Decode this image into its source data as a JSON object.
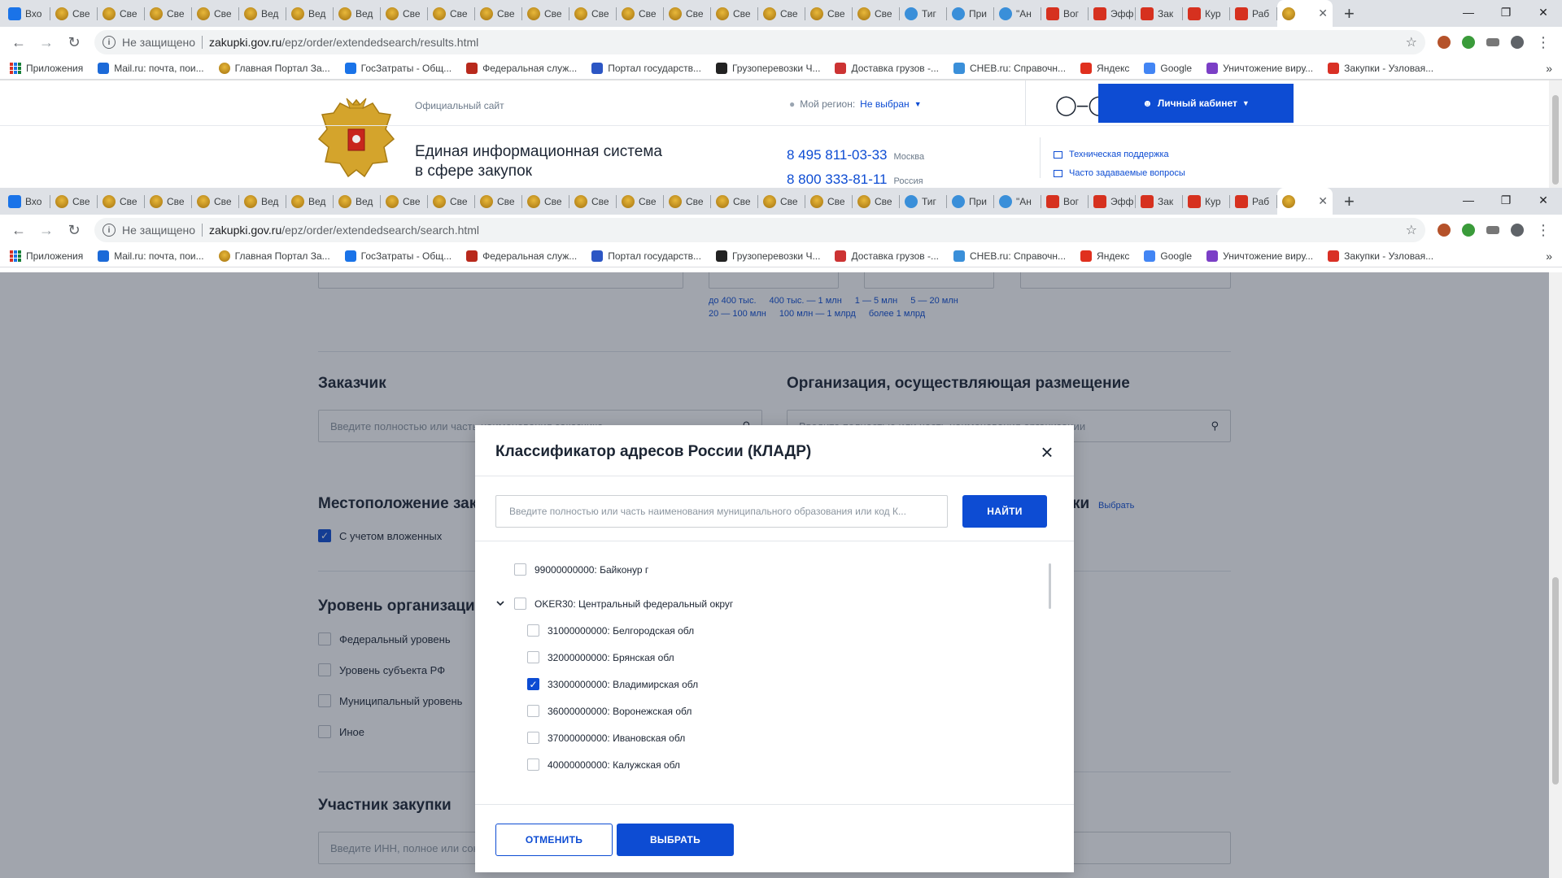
{
  "browser_top": {
    "tabs": [
      {
        "label": "Вхо",
        "icon": "mail-icon"
      },
      {
        "label": "Све",
        "icon": "emblem-icon"
      },
      {
        "label": "Све",
        "icon": "emblem-icon"
      },
      {
        "label": "Све",
        "icon": "emblem-icon"
      },
      {
        "label": "Све",
        "icon": "emblem-icon"
      },
      {
        "label": "Вед",
        "icon": "emblem-icon"
      },
      {
        "label": "Вед",
        "icon": "emblem-icon"
      },
      {
        "label": "Вед",
        "icon": "emblem-icon"
      },
      {
        "label": "Све",
        "icon": "emblem-icon"
      },
      {
        "label": "Све",
        "icon": "emblem-icon"
      },
      {
        "label": "Све",
        "icon": "emblem-icon"
      },
      {
        "label": "Све",
        "icon": "emblem-icon"
      },
      {
        "label": "Све",
        "icon": "emblem-icon"
      },
      {
        "label": "Све",
        "icon": "emblem-icon"
      },
      {
        "label": "Све",
        "icon": "emblem-icon"
      },
      {
        "label": "Све",
        "icon": "emblem-icon"
      },
      {
        "label": "Све",
        "icon": "emblem-icon"
      },
      {
        "label": "Све",
        "icon": "emblem-icon"
      },
      {
        "label": "Све",
        "icon": "emblem-icon"
      },
      {
        "label": "Тиг",
        "icon": "cheb-icon"
      },
      {
        "label": "При",
        "icon": "cheb-icon"
      },
      {
        "label": "\"Ан",
        "icon": "cheb-icon"
      },
      {
        "label": "Вог",
        "icon": "flag-icon"
      },
      {
        "label": "Эфф",
        "icon": "flag-icon"
      },
      {
        "label": "Зак",
        "icon": "flag-icon"
      },
      {
        "label": "Кур",
        "icon": "flag-icon"
      },
      {
        "label": "Раб",
        "icon": "flag-icon"
      }
    ],
    "active_tab_label": "",
    "url_notice": "Не защищено",
    "url_domain": "zakupki.gov.ru",
    "url_path": "/epz/order/extendedsearch/results.html"
  },
  "browser_bottom": {
    "url_notice": "Не защищено",
    "url_domain": "zakupki.gov.ru",
    "url_path": "/epz/order/extendedsearch/search.html"
  },
  "bookmarks": [
    {
      "label": "Приложения",
      "icon": "apps-icon"
    },
    {
      "label": "Mail.ru: почта, пои...",
      "icon": "mailru-icon"
    },
    {
      "label": "Главная Портал За...",
      "icon": "emblem-icon"
    },
    {
      "label": "ГосЗатраты - Общ...",
      "icon": "search-icon"
    },
    {
      "label": "Федеральная служ...",
      "icon": "fns-icon"
    },
    {
      "label": "Портал государств...",
      "icon": "russia-flag-icon"
    },
    {
      "label": "Грузоперевозки Ч...",
      "icon": "triangle-icon"
    },
    {
      "label": "Доставка грузов -...",
      "icon": "star-icon"
    },
    {
      "label": "CHEB.ru: Справочн...",
      "icon": "cheb-icon"
    },
    {
      "label": "Яндекс",
      "icon": "yandex-icon"
    },
    {
      "label": "Google",
      "icon": "google-icon"
    },
    {
      "label": "Уничтожение виру...",
      "icon": "virus-icon"
    },
    {
      "label": "Закупки - Узловая...",
      "icon": "cross-icon"
    }
  ],
  "site": {
    "official": "Официальный сайт",
    "title_line1": "Единая информационная система",
    "title_line2": "в сфере закупок",
    "region_label": "Мой регион:",
    "region_value": "Не выбран",
    "phone1": "8 495 811-03-33",
    "phone1_city": "Москва",
    "phone2": "8 800 333-81-11",
    "phone2_city": "Россия",
    "cabinet": "Личный кабинет",
    "support": "Техническая поддержка",
    "faq": "Часто задаваемые вопросы"
  },
  "page": {
    "price_links_row1": [
      "до 400 тыс.",
      "400 тыс. — 1 млн",
      "1 — 5 млн",
      "5 — 20 млн"
    ],
    "price_links_row2": [
      "20 — 100 млн",
      "100 млн — 1 млрд",
      "более 1 млрд"
    ],
    "customer_title": "Заказчик",
    "customer_placeholder": "Введите полностью или часть наименования заказчика",
    "org_title": "Организация, осуществляющая размещение",
    "org_placeholder": "Введите полностью или часть наименования организации",
    "location_title": "Местоположение зак",
    "location_right": "ки",
    "select_link": "Выбрать",
    "nested_label": "С учетом вложенных",
    "level_title": "Уровень организации",
    "levels": [
      "Федеральный уровень",
      "Уровень субъекта РФ",
      "Муниципальный уровень",
      "Иное"
    ],
    "participant_title": "Участник закупки",
    "participant_placeholder": "Введите ИНН, полное или сокращенное наименование"
  },
  "modal": {
    "title": "Классификатор адресов России (КЛАДР)",
    "search_placeholder": "Введите полностью или часть наименования муниципального образования или код К...",
    "find_button": "НАЙТИ",
    "cancel_button": "ОТМЕНИТЬ",
    "select_button": "ВЫБРАТЬ",
    "tree": [
      {
        "label": "99000000000: Байконур г",
        "checked": false,
        "level": 0
      },
      {
        "label": "OKER30: Центральный федеральный округ",
        "checked": false,
        "level": 0,
        "expanded": true
      },
      {
        "label": "31000000000: Белгородская обл",
        "checked": false,
        "level": 1
      },
      {
        "label": "32000000000: Брянская обл",
        "checked": false,
        "level": 1
      },
      {
        "label": "33000000000: Владимирская обл",
        "checked": true,
        "level": 1
      },
      {
        "label": "36000000000: Воронежская обл",
        "checked": false,
        "level": 1
      },
      {
        "label": "37000000000: Ивановская обл",
        "checked": false,
        "level": 1
      },
      {
        "label": "40000000000: Калужская обл",
        "checked": false,
        "level": 1
      }
    ]
  },
  "colors": {
    "brand_blue": "#0d4cd3"
  }
}
